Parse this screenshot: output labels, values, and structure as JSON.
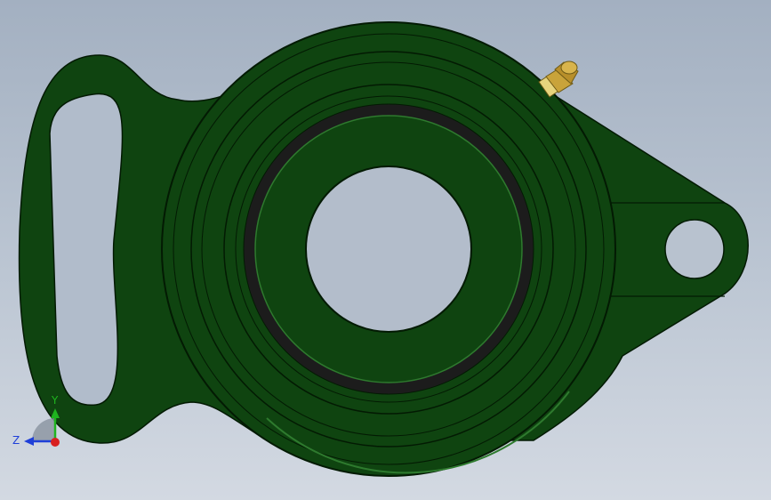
{
  "colors": {
    "background_top": "#a3b0c1",
    "background_bottom": "#d3d9e2",
    "housing": "#0f4410",
    "housing_edge": "#031a03",
    "seal": "#1c1c1c",
    "highlight": "#2e7a2e",
    "fitting": "#c9a33a"
  },
  "triad": {
    "y_label": "Y",
    "z_label": "Z",
    "y_color": "#1fb41f",
    "z_color": "#1f3fd8",
    "x_color": "#d81f1f"
  },
  "icons": {
    "grease_fitting": "grease-nipple-icon",
    "triad": "orientation-triad-icon"
  }
}
